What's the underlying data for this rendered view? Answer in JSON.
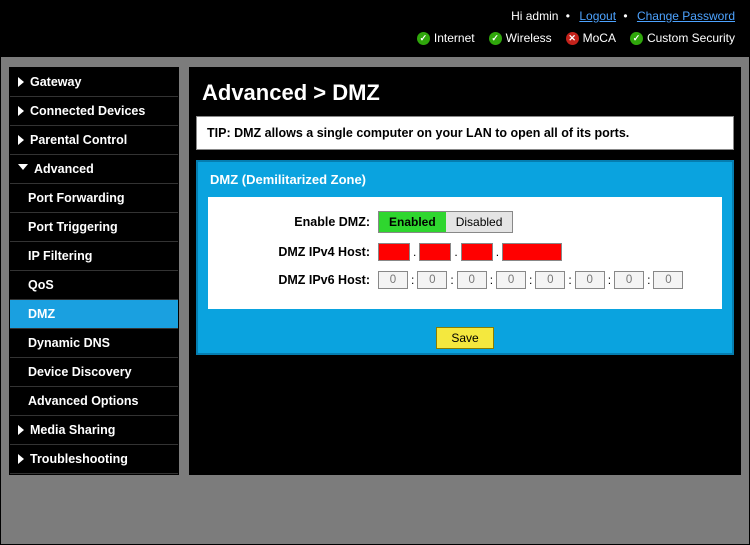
{
  "header": {
    "greeting": "Hi admin",
    "logout": "Logout",
    "change_password": "Change Password",
    "status": [
      {
        "label": "Internet",
        "ok": true
      },
      {
        "label": "Wireless",
        "ok": true
      },
      {
        "label": "MoCA",
        "ok": false
      },
      {
        "label": "Custom Security",
        "ok": true
      }
    ]
  },
  "sidebar": {
    "items": [
      {
        "label": "Gateway",
        "type": "top",
        "expanded": false
      },
      {
        "label": "Connected Devices",
        "type": "top",
        "expanded": false
      },
      {
        "label": "Parental Control",
        "type": "top",
        "expanded": false
      },
      {
        "label": "Advanced",
        "type": "top",
        "expanded": true
      },
      {
        "label": "Port Forwarding",
        "type": "sub",
        "active": false
      },
      {
        "label": "Port Triggering",
        "type": "sub",
        "active": false
      },
      {
        "label": "IP Filtering",
        "type": "sub",
        "active": false
      },
      {
        "label": "QoS",
        "type": "sub",
        "active": false
      },
      {
        "label": "DMZ",
        "type": "sub",
        "active": true
      },
      {
        "label": "Dynamic DNS",
        "type": "sub",
        "active": false
      },
      {
        "label": "Device Discovery",
        "type": "sub",
        "active": false
      },
      {
        "label": "Advanced Options",
        "type": "sub",
        "active": false
      },
      {
        "label": "Media Sharing",
        "type": "top",
        "expanded": false
      },
      {
        "label": "Troubleshooting",
        "type": "top",
        "expanded": false
      }
    ]
  },
  "page": {
    "title": "Advanced > DMZ",
    "tip": "TIP: DMZ allows a single computer on your LAN to open all of its ports.",
    "panel_title": "DMZ (Demilitarized Zone)",
    "enable_label": "Enable DMZ:",
    "enabled_text": "Enabled",
    "disabled_text": "Disabled",
    "enabled_selected": true,
    "ipv4_label": "DMZ IPv4 Host:",
    "ipv4": [
      "",
      "",
      "",
      ""
    ],
    "ipv6_label": "DMZ IPv6 Host:",
    "ipv6": [
      "0",
      "0",
      "0",
      "0",
      "0",
      "0",
      "0",
      "0"
    ],
    "save": "Save"
  }
}
